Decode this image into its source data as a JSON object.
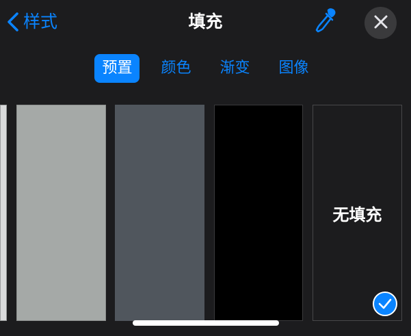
{
  "header": {
    "back_label": "样式",
    "title": "填充"
  },
  "tabs": [
    {
      "label": "预置",
      "active": true
    },
    {
      "label": "颜色",
      "active": false
    },
    {
      "label": "渐变",
      "active": false
    },
    {
      "label": "图像",
      "active": false
    }
  ],
  "swatches": {
    "partial": {
      "color": "#d9dadb"
    },
    "light_gray": {
      "color": "#a5a9a7"
    },
    "dark_gray": {
      "color": "#50565d"
    },
    "black": {
      "color": "#000000"
    },
    "no_fill": {
      "label": "无填充",
      "selected": true
    }
  },
  "colors": {
    "accent": "#0a84ff",
    "background": "#1c1c1e",
    "close_button_bg": "#3a3a3c"
  },
  "icons": {
    "back": "chevron-left-icon",
    "dropper": "eyedropper-icon",
    "close": "close-icon",
    "selected": "checkmark-icon"
  }
}
